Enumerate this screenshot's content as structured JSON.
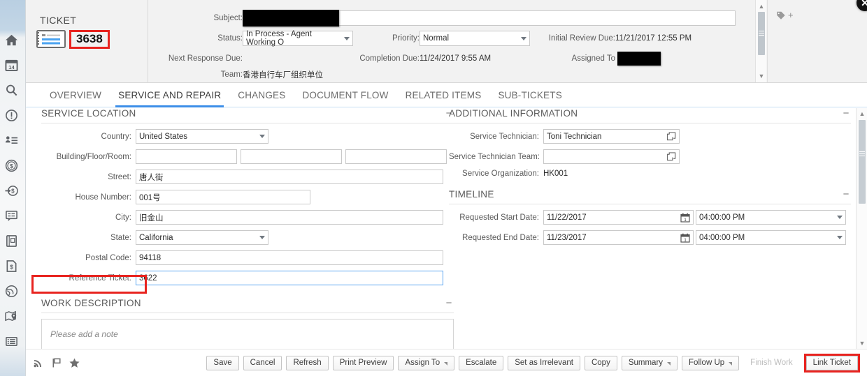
{
  "window": {
    "close_label": "✕"
  },
  "sidebar": {
    "items": [
      {
        "name": "home-icon",
        "label": "Home"
      },
      {
        "name": "calendar-icon",
        "label": "Calendar",
        "day": "14"
      },
      {
        "name": "search-icon",
        "label": "Search"
      },
      {
        "name": "alert-icon",
        "label": "Alerts"
      },
      {
        "name": "contacts-icon",
        "label": "Contacts"
      },
      {
        "name": "coin-dollar-icon",
        "label": "Billing"
      },
      {
        "name": "payment-in-icon",
        "label": "Incoming Payment"
      },
      {
        "name": "chat-bubble-icon",
        "label": "Messages"
      },
      {
        "name": "notebook-icon",
        "label": "Notebook"
      },
      {
        "name": "invoice-icon",
        "label": "Invoice"
      },
      {
        "name": "globe-icon",
        "label": "Global"
      },
      {
        "name": "map-pin-icon",
        "label": "Map"
      },
      {
        "name": "list-icon",
        "label": "List"
      }
    ]
  },
  "header": {
    "ticket_word": "TICKET",
    "ticket_number": "3638",
    "fields": {
      "subject_label": "Subject:",
      "subject_value": "",
      "status_label": "Status:",
      "status_value": "In Process - Agent Working O",
      "priority_label": "Priority:",
      "priority_value": "Normal",
      "initial_review_due_label": "Initial Review Due:",
      "initial_review_due_value": "11/21/2017 12:55 PM",
      "next_response_due_label": "Next Response Due:",
      "next_response_due_value": "",
      "completion_due_label": "Completion Due:",
      "completion_due_value": "11/24/2017 9:55 AM",
      "assigned_to_label": "Assigned To",
      "assigned_to_value": "",
      "team_label": "Team:",
      "team_value": "香港自行车厂组织单位"
    }
  },
  "tabs": [
    {
      "label": "OVERVIEW",
      "active": false
    },
    {
      "label": "SERVICE AND REPAIR",
      "active": true
    },
    {
      "label": "CHANGES",
      "active": false
    },
    {
      "label": "DOCUMENT FLOW",
      "active": false
    },
    {
      "label": "RELATED ITEMS",
      "active": false
    },
    {
      "label": "SUB-TICKETS",
      "active": false
    }
  ],
  "service_location": {
    "title": "SERVICE LOCATION",
    "country_label": "Country:",
    "country_value": "United States",
    "building_label": "Building/Floor/Room:",
    "building_value": "",
    "floor_value": "",
    "room_value": "",
    "street_label": "Street:",
    "street_value": "唐人街",
    "house_number_label": "House Number:",
    "house_number_value": "001号",
    "city_label": "City:",
    "city_value": "旧金山",
    "state_label": "State:",
    "state_value": "California",
    "postal_code_label": "Postal Code:",
    "postal_code_value": "94118",
    "reference_ticket_label": "Reference Ticket:",
    "reference_ticket_value": "3622"
  },
  "work_description": {
    "title": "WORK DESCRIPTION",
    "note_placeholder": "Please add a note"
  },
  "additional_information": {
    "title": "ADDITIONAL INFORMATION",
    "service_technician_label": "Service Technician:",
    "service_technician_value": "Toni Technician",
    "service_technician_team_label": "Service Technician Team:",
    "service_technician_team_value": "",
    "service_organization_label": "Service Organization:",
    "service_organization_value": "HK001"
  },
  "timeline": {
    "title": "TIMELINE",
    "requested_start_date_label": "Requested Start Date:",
    "requested_start_date_value": "11/22/2017",
    "requested_start_time_value": "04:00:00 PM",
    "requested_end_date_label": "Requested End Date:",
    "requested_end_date_value": "11/23/2017",
    "requested_end_time_value": "04:00:00 PM"
  },
  "footer": {
    "buttons": [
      {
        "label": "Save",
        "menu": false,
        "disabled": false,
        "highlighted": false
      },
      {
        "label": "Cancel",
        "menu": false,
        "disabled": false,
        "highlighted": false
      },
      {
        "label": "Refresh",
        "menu": false,
        "disabled": false,
        "highlighted": false
      },
      {
        "label": "Print Preview",
        "menu": false,
        "disabled": false,
        "highlighted": false
      },
      {
        "label": "Assign To",
        "menu": true,
        "disabled": false,
        "highlighted": false
      },
      {
        "label": "Escalate",
        "menu": false,
        "disabled": false,
        "highlighted": false
      },
      {
        "label": "Set as Irrelevant",
        "menu": false,
        "disabled": false,
        "highlighted": false
      },
      {
        "label": "Copy",
        "menu": false,
        "disabled": false,
        "highlighted": false
      },
      {
        "label": "Summary",
        "menu": true,
        "disabled": false,
        "highlighted": false
      },
      {
        "label": "Follow Up",
        "menu": true,
        "disabled": false,
        "highlighted": false
      },
      {
        "label": "Finish Work",
        "menu": false,
        "disabled": true,
        "highlighted": false
      },
      {
        "label": "Link Ticket",
        "menu": false,
        "disabled": false,
        "highlighted": true
      }
    ]
  },
  "colors": {
    "accent_blue": "#3c8ee8",
    "highlight_red": "#e8231f",
    "header_bg": "#f2f2f2",
    "focus_border": "#5aa5f0"
  }
}
